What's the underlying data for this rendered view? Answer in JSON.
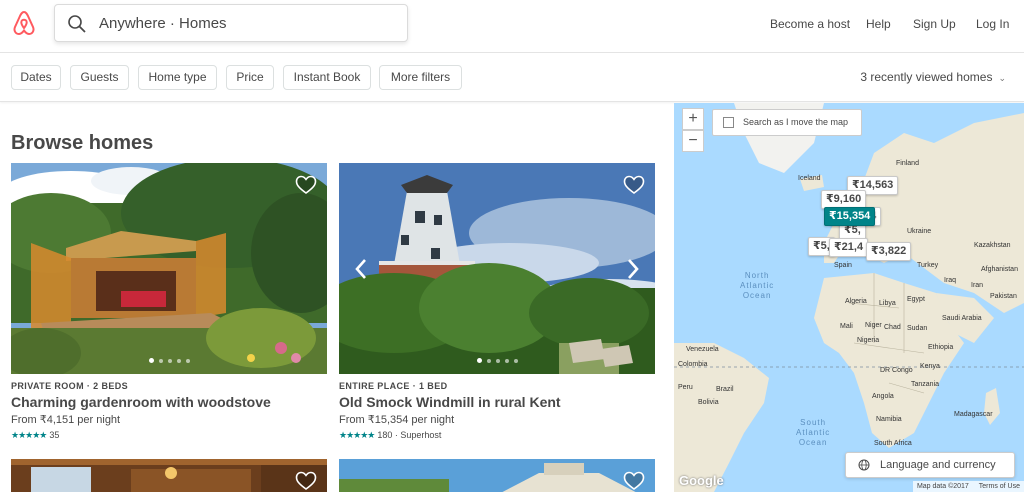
{
  "header": {
    "search_text": "Anywhere · Homes",
    "nav": [
      "Become a host",
      "Help",
      "Sign Up",
      "Log In"
    ]
  },
  "filters": {
    "buttons": [
      "Dates",
      "Guests",
      "Home type",
      "Price",
      "Instant Book",
      "More filters"
    ],
    "recently_viewed": "3 recently viewed homes"
  },
  "browse": {
    "title": "Browse homes",
    "cards": [
      {
        "type": "PRIVATE ROOM · 2 BEDS",
        "title": "Charming gardenroom with woodstove",
        "price": "From ₹4,151 per night",
        "stars": "★★★★★",
        "rating": "35"
      },
      {
        "type": "ENTIRE PLACE · 1 BED",
        "title": "Old Smock Windmill in rural Kent",
        "price": "From ₹15,354 per night",
        "stars": "★★★★★",
        "rating": "180 · Superhost"
      }
    ]
  },
  "map": {
    "zoom_in": "+",
    "zoom_out": "−",
    "search_move": "Search as I move the map",
    "pills": [
      "₹14,563",
      "₹9,160",
      "₹15,354",
      "₹5,",
      "₹21,4",
      "₹3,822"
    ],
    "labels": {
      "iceland": "Iceland",
      "finland": "Finland",
      "ukraine": "Ukraine",
      "kazakhstan": "Kazakhstan",
      "spain": "Spain",
      "turkey": "Turkey",
      "iraq": "Iraq",
      "iran": "Iran",
      "afghanistan": "Afghanistan",
      "pakistan": "Pakistan",
      "algeria": "Algeria",
      "libya": "Libya",
      "egypt": "Egypt",
      "saudi": "Saudi Arabia",
      "mali": "Mali",
      "niger": "Niger",
      "chad": "Chad",
      "sudan": "Sudan",
      "nigeria": "Nigeria",
      "ethiopia": "Ethiopia",
      "kenya": "Kenya",
      "drc": "DR Congo",
      "tanzania": "Tanzania",
      "angola": "Angola",
      "namibia": "Namibia",
      "madagascar": "Madagascar",
      "south_africa": "South Africa",
      "venezuela": "Venezuela",
      "colombia": "Colombia",
      "peru": "Peru",
      "brazil": "Brazil",
      "bolivia": "Bolivia"
    },
    "ocean_north": "North\nAtlantic\nOcean",
    "ocean_south": "South\nAtlantic\nOcean",
    "language_button": "Language and currency",
    "google": "Google",
    "map_data": "Map data ©2017",
    "terms": "Terms of Use"
  },
  "colors": {
    "brand": "#FF5A5F",
    "teal": "#008489",
    "water": "#aadaff",
    "land": "#ede8d7"
  }
}
